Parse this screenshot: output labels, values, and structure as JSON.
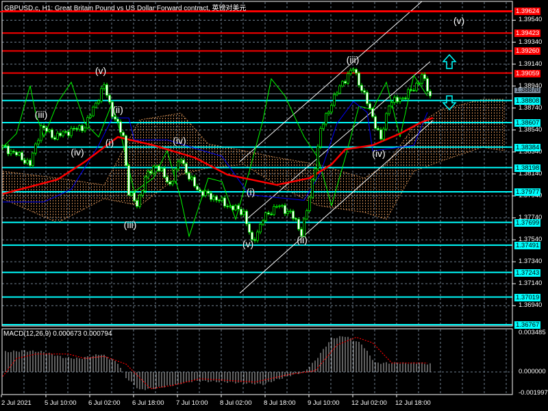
{
  "header": {
    "title": "GBPUSD.c, H1:  Great Britain Pound vs US Dollar Forward contract, 英镑对美元"
  },
  "colors": {
    "bg": "#000000",
    "bull": "#00ff00",
    "bear": "#ffffff",
    "resistance": "#ff0000",
    "support": "#00ffff",
    "ma": "#ff0000",
    "kijun": "#0000ff",
    "green_line": "#00ff00",
    "cloud": "#f4a460",
    "macd_signal": "#ff0000",
    "macd_hist": "#c0c0c0",
    "grid": "#708090"
  },
  "chart_data": {
    "type": "candlestick",
    "symbol": "GBPUSD.c",
    "timeframe": "H1",
    "ylim": [
      1.367,
      1.397
    ],
    "price_ticks": [
      "1.39540",
      "1.39340",
      "1.39140",
      "1.38940",
      "1.38740",
      "1.38540",
      "1.38340",
      "1.38140",
      "1.37940",
      "1.37740",
      "1.37540",
      "1.37340",
      "1.37140",
      "1.36940"
    ],
    "current_price": "1.38870",
    "resistance_levels": [
      "1.39624",
      "1.39423",
      "1.39260",
      "1.39059"
    ],
    "support_levels": [
      "1.38808",
      "1.38607",
      "1.38384",
      "1.38198",
      "1.37977",
      "1.37699",
      "1.37491",
      "1.37243",
      "1.37019",
      "1.36767"
    ],
    "time_labels": [
      "2 Jul 2021",
      "5 Jul 10:00",
      "6 Jul 02:00",
      "6 Jul 18:00",
      "7 Jul 10:00",
      "8 Jul 02:00",
      "8 Jul 18:00",
      "9 Jul 10:00",
      "12 Jul 02:00",
      "12 Jul 18:00"
    ],
    "close_keypoints": [
      [
        0,
        1.38383
      ],
      [
        5,
        1.3832
      ],
      [
        10,
        1.38227
      ],
      [
        14,
        1.3857
      ],
      [
        19,
        1.38476
      ],
      [
        25,
        1.38539
      ],
      [
        30,
        1.3857
      ],
      [
        34,
        1.38788
      ],
      [
        37,
        1.38944
      ],
      [
        40,
        1.38695
      ],
      [
        44,
        1.38476
      ],
      [
        46,
        1.37977
      ],
      [
        49,
        1.37852
      ],
      [
        52,
        1.38102
      ],
      [
        56,
        1.38227
      ],
      [
        61,
        1.3804
      ],
      [
        65,
        1.38289
      ],
      [
        68,
        1.38102
      ],
      [
        72,
        1.37977
      ],
      [
        78,
        1.37915
      ],
      [
        82,
        1.37852
      ],
      [
        88,
        1.3779
      ],
      [
        91,
        1.37509
      ],
      [
        95,
        1.37728
      ],
      [
        100,
        1.37852
      ],
      [
        105,
        1.3779
      ],
      [
        109,
        1.37603
      ],
      [
        112,
        1.37915
      ],
      [
        116,
        1.38539
      ],
      [
        120,
        1.38788
      ],
      [
        124,
        1.38975
      ],
      [
        128,
        1.391
      ],
      [
        131,
        1.38913
      ],
      [
        135,
        1.38663
      ],
      [
        138,
        1.38445
      ],
      [
        141,
        1.38788
      ],
      [
        145,
        1.38819
      ],
      [
        150,
        1.38913
      ],
      [
        153,
        1.39038
      ],
      [
        156,
        1.3885
      ]
    ],
    "ma_keypoints": [
      [
        0,
        1.37958
      ],
      [
        20,
        1.38089
      ],
      [
        30,
        1.38251
      ],
      [
        37,
        1.38383
      ],
      [
        42,
        1.38476
      ],
      [
        55,
        1.38401
      ],
      [
        70,
        1.38289
      ],
      [
        82,
        1.38133
      ],
      [
        100,
        1.3804
      ],
      [
        112,
        1.38102
      ],
      [
        120,
        1.38227
      ],
      [
        125,
        1.38364
      ],
      [
        135,
        1.38401
      ],
      [
        145,
        1.38507
      ],
      [
        152,
        1.38601
      ],
      [
        157,
        1.38651
      ]
    ],
    "kijun_keypoints": [
      [
        0,
        1.37884
      ],
      [
        15,
        1.37884
      ],
      [
        25,
        1.38
      ],
      [
        35,
        1.384
      ],
      [
        40,
        1.3865
      ],
      [
        46,
        1.3865
      ],
      [
        48,
        1.3845
      ],
      [
        60,
        1.3845
      ],
      [
        80,
        1.383
      ],
      [
        90,
        1.3795
      ],
      [
        110,
        1.379
      ],
      [
        116,
        1.3815
      ],
      [
        122,
        1.386
      ],
      [
        128,
        1.388
      ],
      [
        133,
        1.387
      ],
      [
        135,
        1.3835
      ],
      [
        150,
        1.384
      ],
      [
        155,
        1.387
      ]
    ],
    "green_keypoints": [
      [
        0,
        1.38382
      ],
      [
        5,
        1.38507
      ],
      [
        10,
        1.38944
      ],
      [
        12,
        1.38694
      ],
      [
        15,
        1.38476
      ],
      [
        20,
        1.38788
      ],
      [
        25,
        1.38975
      ],
      [
        30,
        1.38601
      ],
      [
        35,
        1.38476
      ],
      [
        40,
        1.38788
      ],
      [
        43,
        1.38507
      ],
      [
        48,
        1.37977
      ],
      [
        55,
        1.38102
      ],
      [
        60,
        1.38351
      ],
      [
        65,
        1.37914
      ],
      [
        68,
        1.37571
      ],
      [
        75,
        1.38102
      ],
      [
        80,
        1.3807
      ],
      [
        85,
        1.37727
      ],
      [
        90,
        1.38164
      ],
      [
        95,
        1.38632
      ],
      [
        98,
        1.39006
      ],
      [
        103,
        1.3885
      ],
      [
        110,
        1.38476
      ],
      [
        115,
        1.38289
      ],
      [
        120,
        1.37852
      ],
      [
        125,
        1.38289
      ],
      [
        130,
        1.38757
      ],
      [
        135,
        1.38725
      ],
      [
        140,
        1.38975
      ],
      [
        145,
        1.38476
      ],
      [
        150,
        1.39037
      ],
      [
        155,
        1.3885
      ]
    ],
    "cloud_keypoints": [
      [
        0,
        1.38164,
        1.37914
      ],
      [
        20,
        1.38102,
        1.37696
      ],
      [
        37,
        1.38039,
        1.37914
      ],
      [
        50,
        1.38632,
        1.37852
      ],
      [
        65,
        1.38694,
        1.38133
      ],
      [
        75,
        1.38413,
        1.38195
      ],
      [
        88,
        1.38351,
        1.38226
      ],
      [
        100,
        1.38289,
        1.38039
      ],
      [
        115,
        1.38226,
        1.37852
      ],
      [
        132,
        1.38102,
        1.3779
      ],
      [
        140,
        1.38226,
        1.37727
      ],
      [
        150,
        1.3857,
        1.38164
      ],
      [
        160,
        1.38725,
        1.38257
      ],
      [
        175,
        1.38819,
        1.38382
      ],
      [
        183,
        1.38819,
        1.38351
      ]
    ],
    "wave_labels": [
      "(v)",
      "(iii)",
      "(v)",
      "(iii)",
      "(ii)",
      "(iv)",
      "(i)",
      "(iv)",
      "(iii)",
      "(i)",
      "(v)",
      "(ii)",
      "(iv)"
    ],
    "macd": {
      "title": "MACD(12,26,9) 0.000673 0.000794",
      "params": "12,26,9",
      "main": 0.000673,
      "signal": 0.000794,
      "ticks": [
        "0.003485",
        "0.000000",
        "-0.001997"
      ],
      "ylim": [
        -0.001997,
        0.003485
      ],
      "hist_keypoints": [
        [
          1,
          0.0018
        ],
        [
          8,
          0.0019
        ],
        [
          15,
          0.0018
        ],
        [
          22,
          0.0013
        ],
        [
          28,
          0.0012
        ],
        [
          36,
          0.0016
        ],
        [
          42,
          0.0008
        ],
        [
          45,
          -0.0005
        ],
        [
          50,
          -0.0016
        ],
        [
          57,
          -0.0014
        ],
        [
          70,
          -0.0008
        ],
        [
          82,
          -0.0009
        ],
        [
          95,
          -0.0011
        ],
        [
          105,
          -0.0003
        ],
        [
          110,
          0.0
        ],
        [
          114,
          0.001
        ],
        [
          120,
          0.003
        ],
        [
          125,
          0.0032
        ],
        [
          131,
          0.0025
        ],
        [
          136,
          0.0008
        ],
        [
          140,
          0.0008
        ],
        [
          152,
          0.0008
        ],
        [
          156,
          0.0007
        ]
      ],
      "signal_keypoints": [
        [
          0,
          -0.0004
        ],
        [
          5,
          0.0012
        ],
        [
          12,
          0.0016
        ],
        [
          24,
          0.0016
        ],
        [
          30,
          0.0012
        ],
        [
          37,
          0.0014
        ],
        [
          45,
          0.0007
        ],
        [
          54,
          -0.0015
        ],
        [
          62,
          -0.0012
        ],
        [
          72,
          -0.0006
        ],
        [
          92,
          -0.0009
        ],
        [
          105,
          -0.0002
        ],
        [
          114,
          0.0001
        ],
        [
          122,
          0.0024
        ],
        [
          129,
          0.0031
        ],
        [
          135,
          0.0026
        ],
        [
          142,
          0.0008
        ],
        [
          155,
          0.0008
        ]
      ]
    }
  }
}
